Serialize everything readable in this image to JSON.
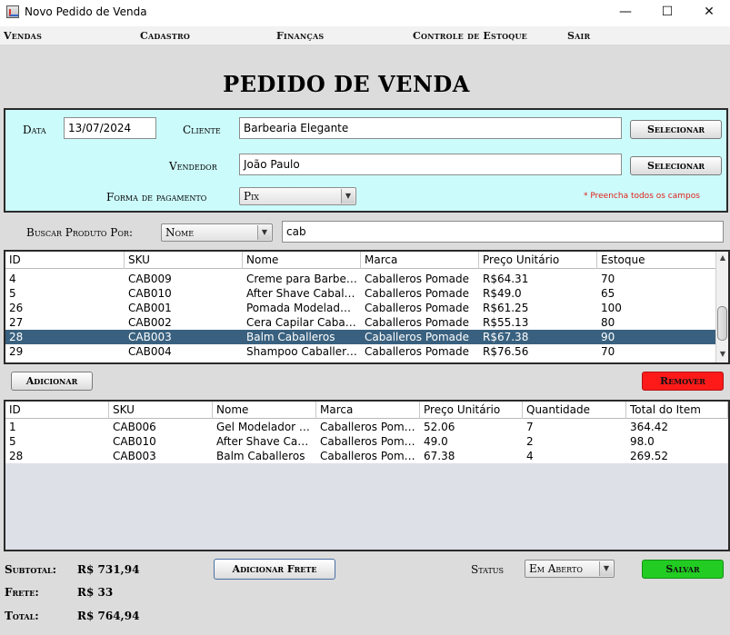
{
  "window": {
    "title": "Novo Pedido de Venda",
    "minimize": "—",
    "maximize": "☐",
    "close": "✕"
  },
  "menu": [
    "Vendas",
    "Cadastro",
    "Finanças",
    "Controle de Estoque",
    "Sair"
  ],
  "page_title": "PEDIDO DE VENDA",
  "form": {
    "date_label": "Data",
    "date_value": "13/07/2024",
    "client_label": "Cliente",
    "client_value": "Barbearia Elegante",
    "select_client_button": "Selecionar",
    "seller_label": "Vendedor",
    "seller_value": "João Paulo",
    "select_seller_button": "Selecionar",
    "payment_label": "Forma de pagamento",
    "payment_value": "Pix",
    "required_note": "* Preencha todos os campos"
  },
  "search": {
    "label": "Buscar Produto Por:",
    "field_value": "Nome",
    "query": "cab"
  },
  "products_table": {
    "headers": [
      "ID",
      "SKU",
      "Nome",
      "Marca",
      "Preço Unitário",
      "Estoque"
    ],
    "rows": [
      [
        "4",
        "CAB009",
        "Creme para Barbear Caballeros",
        "Caballeros Pomade",
        "R$64.31",
        "70"
      ],
      [
        "5",
        "CAB010",
        "After Shave Caballeros",
        "Caballeros Pomade",
        "R$49.0",
        "65"
      ],
      [
        "26",
        "CAB001",
        "Pomada Modeladora Caballeros",
        "Caballeros Pomade",
        "R$61.25",
        "100"
      ],
      [
        "27",
        "CAB002",
        "Cera Capilar Caballeros",
        "Caballeros Pomade",
        "R$55.13",
        "80"
      ],
      [
        "28",
        "CAB003",
        "Balm Caballeros",
        "Caballeros Pomade",
        "R$67.38",
        "90"
      ],
      [
        "29",
        "CAB004",
        "Shampoo Caballeros",
        "Caballeros Pomade",
        "R$76.56",
        "70"
      ]
    ],
    "selected_row": 4
  },
  "actions": {
    "add_button": "Adicionar",
    "remove_button": "Remover"
  },
  "items_table": {
    "headers": [
      "ID",
      "SKU",
      "Nome",
      "Marca",
      "Preço Unitário",
      "Quantidade",
      "Total do Item"
    ],
    "rows": [
      [
        "1",
        "CAB006",
        "Gel Modelador Caballeros",
        "Caballeros Pomade",
        "52.06",
        "7",
        "364.42"
      ],
      [
        "5",
        "CAB010",
        "After Shave Caballeros",
        "Caballeros Pomade",
        "49.0",
        "2",
        "98.0"
      ],
      [
        "28",
        "CAB003",
        "Balm Caballeros",
        "Caballeros Pomade",
        "67.38",
        "4",
        "269.52"
      ]
    ]
  },
  "totals": {
    "subtotal_label": "Subtotal:",
    "subtotal_value": "R$ 731,94",
    "freight_label": "Frete:",
    "freight_value": "R$ 33",
    "total_label": "Total:",
    "total_value": "R$ 764,94"
  },
  "freight_button": "Adicionar Frete",
  "status": {
    "label": "Status",
    "value": "Em Aberto"
  },
  "save_button": "Salvar",
  "colors": {
    "form_bg": "#ccfbfb",
    "selection": "#39617f",
    "remove_button": "#ff1a1a",
    "save_button": "#22cc22",
    "required_text": "#e0201a"
  }
}
